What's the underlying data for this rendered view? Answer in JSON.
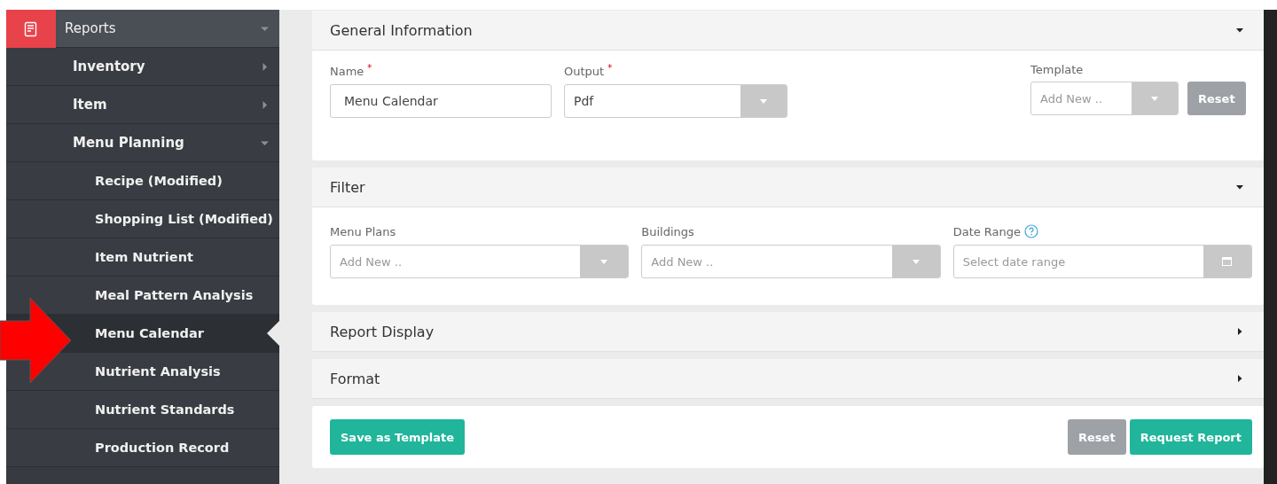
{
  "sidebar": {
    "items": [
      {
        "label": "Reports",
        "expanded": true,
        "selected": false,
        "children": [
          {
            "label": "Inventory",
            "expanded": false,
            "selected": false
          },
          {
            "label": "Item",
            "expanded": false,
            "selected": false
          },
          {
            "label": "Menu Planning",
            "expanded": true,
            "selected": false,
            "children": [
              {
                "label": "Recipe (Modified)",
                "selected": false
              },
              {
                "label": "Shopping List (Modified)",
                "selected": false
              },
              {
                "label": "Item Nutrient",
                "selected": false
              },
              {
                "label": "Meal Pattern Analysis",
                "selected": false
              },
              {
                "label": "Menu Calendar",
                "selected": true
              },
              {
                "label": "Nutrient Analysis",
                "selected": false
              },
              {
                "label": "Nutrient Standards",
                "selected": false
              },
              {
                "label": "Production Record",
                "selected": false
              }
            ]
          }
        ]
      }
    ]
  },
  "panels": [
    {
      "title": "General Information",
      "expanded": true,
      "kind": "general",
      "fields": [
        {
          "label": "Name",
          "required_mark": "*",
          "kind": "text",
          "value": "Menu Calendar"
        },
        {
          "label": "Output",
          "required_mark": "*",
          "kind": "select",
          "value": "Pdf"
        }
      ],
      "template": {
        "label": "Template",
        "placeholder": "Add New ..",
        "button": "Reset"
      }
    },
    {
      "title": "Filter",
      "expanded": true,
      "kind": "filter",
      "fields": [
        {
          "label": "Menu Plans",
          "kind": "select",
          "placeholder": "Add New .."
        },
        {
          "label": "Buildings",
          "kind": "select",
          "placeholder": "Add New .."
        },
        {
          "label": "Date Range",
          "help": true,
          "kind": "date",
          "placeholder": "Select date range"
        }
      ]
    },
    {
      "title": "Report Display",
      "expanded": false
    },
    {
      "title": "Format",
      "expanded": false
    }
  ],
  "footer": {
    "save_template": "Save as Template",
    "reset": "Reset",
    "request": "Request Report"
  }
}
